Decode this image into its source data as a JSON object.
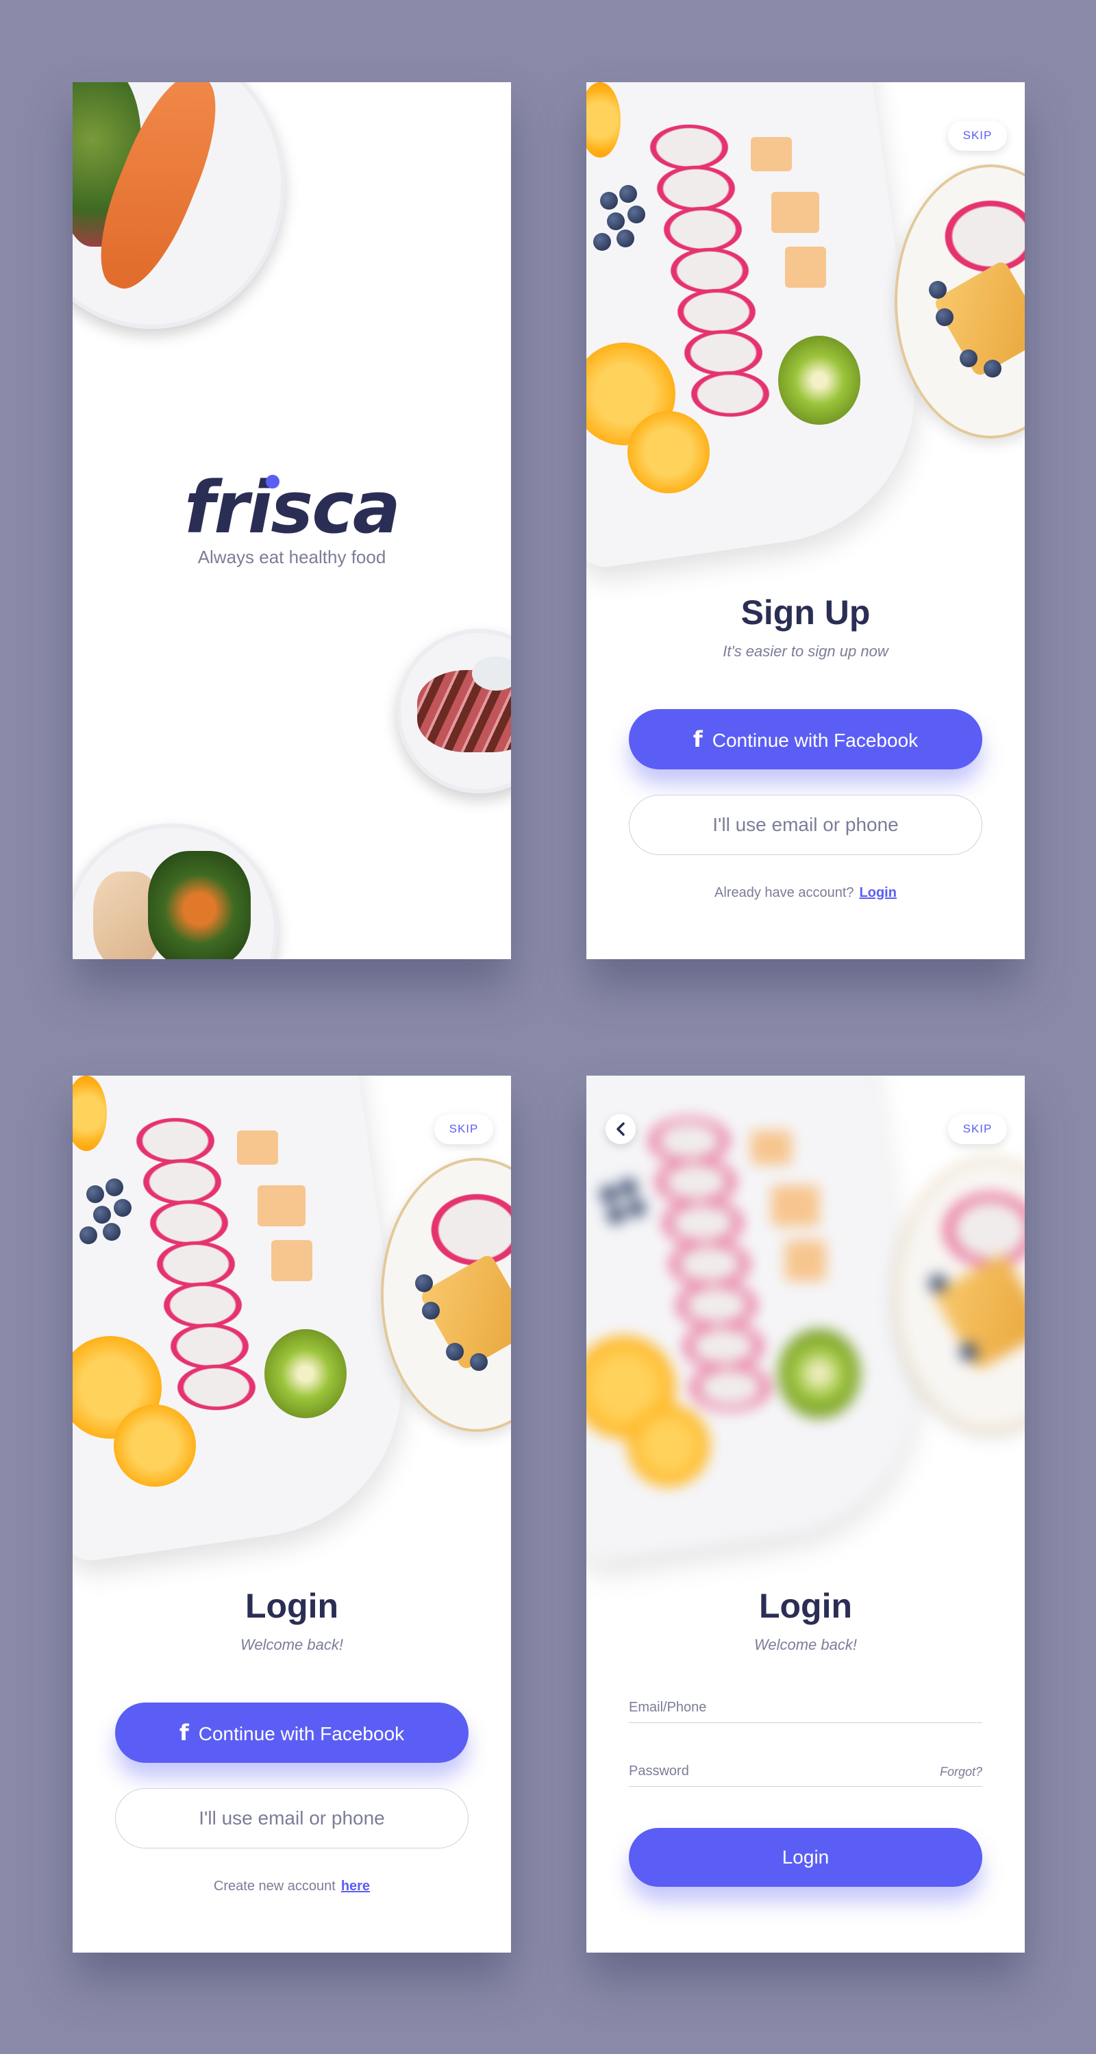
{
  "colors": {
    "background": "#8a8aa8",
    "accent": "#5b5ef4",
    "text_dark": "#2b2e54",
    "text_muted": "#7b7d98"
  },
  "splash": {
    "logo": "frisca",
    "tagline": "Always eat healthy food"
  },
  "signup": {
    "skip_label": "SKIP",
    "title": "Sign Up",
    "subtitle": "It's easier to sign up now",
    "facebook_icon": "f",
    "facebook_label": "Continue with Facebook",
    "email_label": "I'll use email or phone",
    "footer_text": "Already have account?",
    "footer_link": "Login"
  },
  "login": {
    "skip_label": "SKIP",
    "title": "Login",
    "subtitle": "Welcome back!",
    "facebook_icon": "f",
    "facebook_label": "Continue with Facebook",
    "email_label": "I'll use email or phone",
    "footer_text": "Create new account",
    "footer_link": "here"
  },
  "login_form": {
    "skip_label": "SKIP",
    "back_icon": "chevron-left-icon",
    "title": "Login",
    "subtitle": "Welcome back!",
    "email_label": "Email/Phone",
    "password_label": "Password",
    "forgot_label": "Forgot?",
    "login_button": "Login"
  }
}
